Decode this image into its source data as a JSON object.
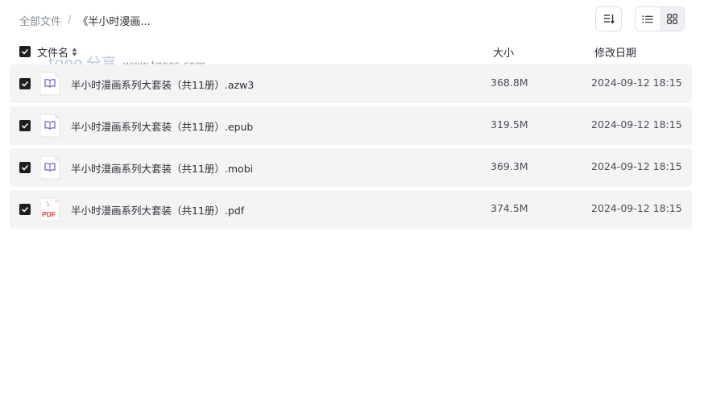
{
  "breadcrumb": {
    "root": "全部文件",
    "separator": "/",
    "current": "《半小时漫画..."
  },
  "toolbar": {
    "sort_icon": "sort-icon",
    "list_view_icon": "list-view-icon",
    "grid_view_icon": "grid-view-icon",
    "active_view": "grid"
  },
  "header": {
    "name": "文件名",
    "size": "大小",
    "date": "修改日期",
    "all_checked": true
  },
  "watermark": {
    "logo": "tgoo",
    "cn": "分享",
    "url": "www.tgoos.com"
  },
  "files": [
    {
      "name": "半小时漫画系列大套装（共11册）.azw3",
      "size": "368.8M",
      "date": "2024-09-12 18:15",
      "icon": "ebook-icon",
      "checked": true
    },
    {
      "name": "半小时漫画系列大套装（共11册）.epub",
      "size": "319.5M",
      "date": "2024-09-12 18:15",
      "icon": "ebook-icon",
      "checked": true
    },
    {
      "name": "半小时漫画系列大套装（共11册）.mobi",
      "size": "369.3M",
      "date": "2024-09-12 18:15",
      "icon": "ebook-icon",
      "checked": true
    },
    {
      "name": "半小时漫画系列大套装（共11册）.pdf",
      "size": "374.5M",
      "date": "2024-09-12 18:15",
      "icon": "pdf-icon",
      "pdf_label": "PDF",
      "checked": true
    }
  ],
  "colors": {
    "row_bg": "#f4f4f5",
    "ebook_accent": "#7b6fe0",
    "pdf_accent": "#e0403a",
    "checkbox": "#1f1f1f"
  }
}
